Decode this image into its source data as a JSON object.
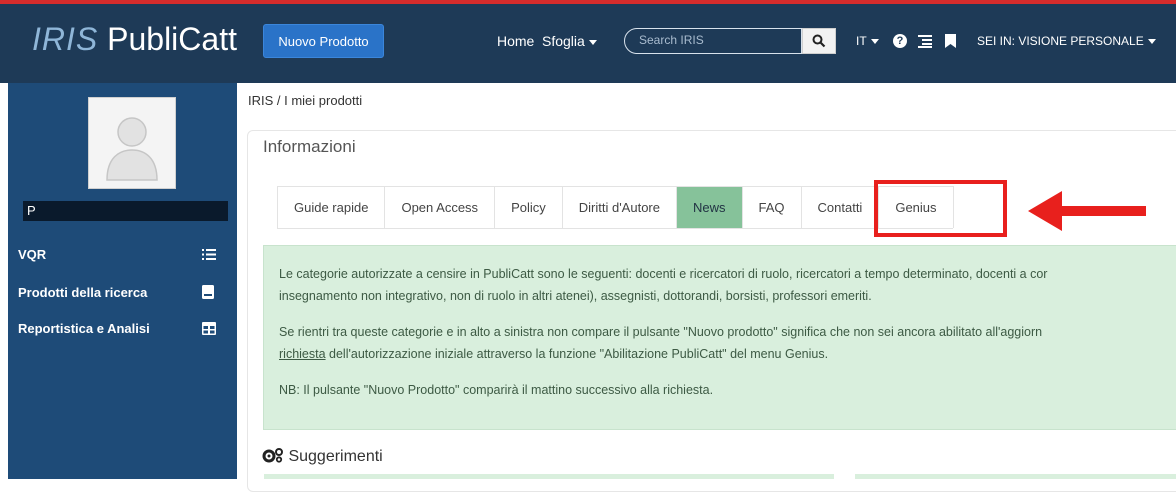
{
  "header": {
    "logo_iris": "IRIS",
    "logo_name": "PubliCatt",
    "new_product_label": "Nuovo Prodotto",
    "home_label": "Home",
    "browse_label": "Sfoglia",
    "search_placeholder": "Search IRIS",
    "language": "IT",
    "user_context": "SEI IN: VISIONE PERSONALE"
  },
  "sidebar": {
    "user_initial": "P",
    "items": [
      {
        "label": "VQR"
      },
      {
        "label": "Prodotti della ricerca"
      },
      {
        "label": "Reportistica e Analisi"
      }
    ]
  },
  "breadcrumb": "IRIS  /  I miei prodotti",
  "panel": {
    "title": "Informazioni",
    "tabs": [
      {
        "label": "Guide rapide"
      },
      {
        "label": "Open Access"
      },
      {
        "label": "Policy"
      },
      {
        "label": "Diritti d'Autore"
      },
      {
        "label": "News",
        "active": true
      },
      {
        "label": "FAQ"
      },
      {
        "label": "Contatti"
      },
      {
        "label": "Genius"
      }
    ]
  },
  "news": {
    "p1_line1": "Le categorie autorizzate a censire in PubliCatt sono le seguenti: docenti e ricercatori di ruolo, ricercatori a tempo determinato, docenti a cor",
    "p1_line2": "insegnamento non integrativo, non di ruolo in altri atenei), assegnisti, dottorandi, borsisti, professori emeriti.",
    "p2_line1": "Se rientri tra queste categorie e in alto a sinistra non compare il pulsante \"Nuovo prodotto\" significa che non sei ancora abilitato all'aggiorn",
    "p2_link": "richiesta",
    "p2_line2_rest": " dell'autorizzazione iniziale attraverso la funzione \"Abilitazione PubliCatt\" del menu Genius.",
    "p3": "NB: Il pulsante \"Nuovo Prodotto\" comparirà il mattino successivo alla richiesta."
  },
  "suggestions_title": "Suggerimenti",
  "colors": {
    "header_bg": "#1e3a57",
    "sidebar_bg": "#1e4b78",
    "accent_button": "#2a73c8",
    "active_tab": "#86c29a",
    "news_bg": "#d9efdd",
    "highlight": "#e8201d"
  }
}
